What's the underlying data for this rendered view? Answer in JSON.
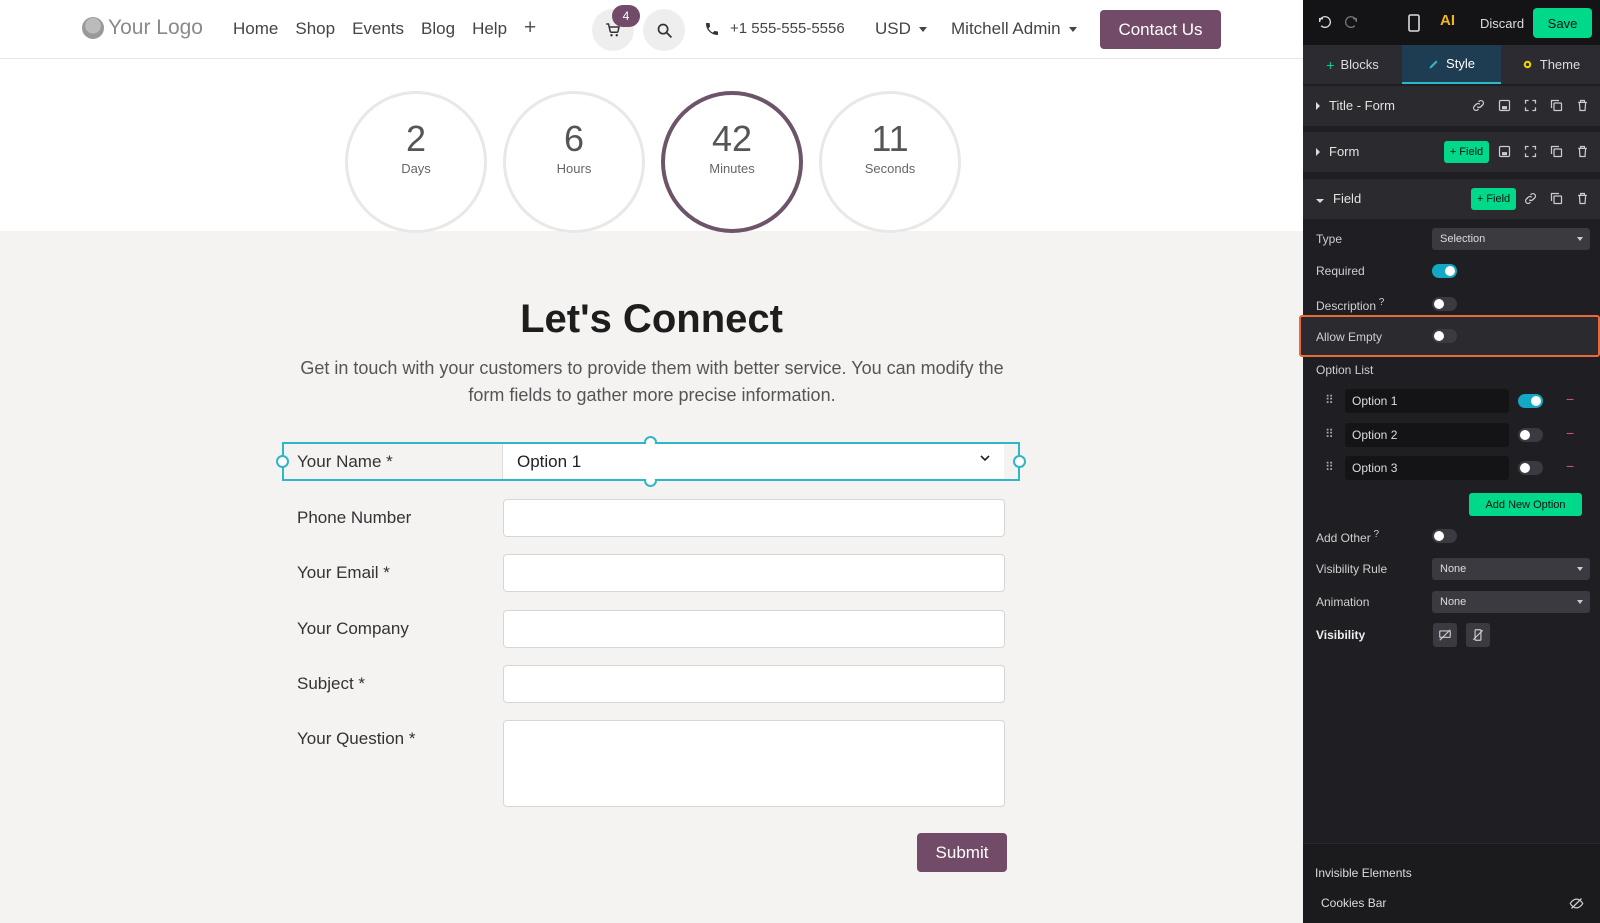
{
  "header": {
    "logo_text": "Your Logo",
    "nav": [
      "Home",
      "Shop",
      "Events",
      "Blog",
      "Help"
    ],
    "plus": "+",
    "cart_count": "4",
    "phone": "+1 555-555-5556",
    "currency": "USD",
    "user": "Mitchell Admin",
    "contact_label": "Contact Us",
    "brand_color": "#714b67"
  },
  "countdown": [
    {
      "value": "2",
      "unit": "Days"
    },
    {
      "value": "6",
      "unit": "Hours"
    },
    {
      "value": "42",
      "unit": "Minutes"
    },
    {
      "value": "11",
      "unit": "Seconds"
    }
  ],
  "form": {
    "title": "Let's Connect",
    "subtitle": "Get in touch with your customers to provide them with better service. You can modify the form fields to gather more precise information.",
    "fields": [
      {
        "label": "Your Name *",
        "value": "Option 1"
      },
      {
        "label": "Phone Number",
        "value": ""
      },
      {
        "label": "Your Email *",
        "value": ""
      },
      {
        "label": "Your Company",
        "value": ""
      },
      {
        "label": "Subject *",
        "value": ""
      },
      {
        "label": "Your Question *",
        "value": ""
      }
    ],
    "submit_label": "Submit"
  },
  "panel": {
    "discard_label": "Discard",
    "save_label": "Save",
    "ai_label": "AI",
    "tabs": [
      "Blocks",
      "Style",
      "Theme"
    ],
    "sections": [
      "Title - Form",
      "Form",
      "Field"
    ],
    "field_button_label": "+ Field",
    "props": {
      "type_label": "Type",
      "type_value": "Selection",
      "required_label": "Required",
      "required_on": true,
      "description_label": "Description",
      "allow_empty_label": "Allow Empty",
      "option_list_label": "Option List",
      "options": [
        {
          "label": "Option 1",
          "on": true
        },
        {
          "label": "Option 2",
          "on": false
        },
        {
          "label": "Option 3",
          "on": false
        }
      ],
      "add_option_label": "Add New Option",
      "add_other_label": "Add Other",
      "visibility_rule_label": "Visibility Rule",
      "visibility_rule_value": "None",
      "animation_label": "Animation",
      "animation_value": "None",
      "visibility_label": "Visibility"
    },
    "invisible_elements_label": "Invisible Elements",
    "cookies_bar_label": "Cookies Bar",
    "accent": "#00d98a",
    "highlight_color": "#e76a3f"
  }
}
